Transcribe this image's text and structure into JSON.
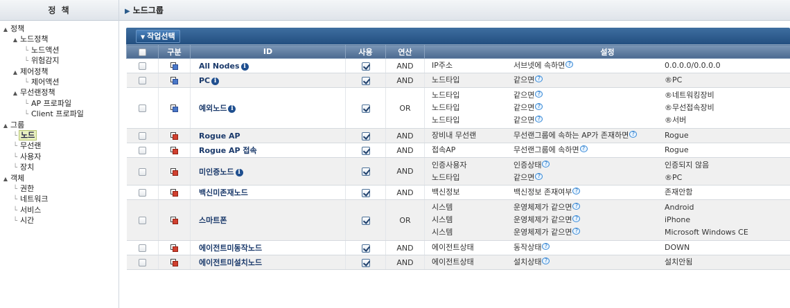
{
  "left_panel": {
    "title": "정 책",
    "tree": [
      {
        "label": "정책",
        "level": 0,
        "expanded": true
      },
      {
        "label": "노드정책",
        "level": 1,
        "expanded": true
      },
      {
        "label": "노드액션",
        "level": 2
      },
      {
        "label": "위험감지",
        "level": 2
      },
      {
        "label": "제어정책",
        "level": 1,
        "expanded": true
      },
      {
        "label": "제어액션",
        "level": 2
      },
      {
        "label": "무선랜정책",
        "level": 1,
        "expanded": true
      },
      {
        "label": "AP 프로파일",
        "level": 2
      },
      {
        "label": "Client 프로파일",
        "level": 2
      },
      {
        "label": "그룹",
        "level": 0,
        "expanded": true
      },
      {
        "label": "노드",
        "level": 1,
        "selected": true
      },
      {
        "label": "무선랜",
        "level": 1
      },
      {
        "label": "사용자",
        "level": 1
      },
      {
        "label": "장치",
        "level": 1
      },
      {
        "label": "객체",
        "level": 0,
        "expanded": true
      },
      {
        "label": "권한",
        "level": 1
      },
      {
        "label": "네트워크",
        "level": 1
      },
      {
        "label": "서비스",
        "level": 1
      },
      {
        "label": "시간",
        "level": 1
      }
    ]
  },
  "main": {
    "breadcrumb": "노드그룹",
    "action_button": "작업선택",
    "columns": {
      "type": "구분",
      "id": "ID",
      "use": "사용",
      "op": "연산",
      "settings": "설정"
    },
    "rows": [
      {
        "id": "All Nodes",
        "info": true,
        "icon": "blue",
        "op": "AND",
        "conds": [
          [
            "IP주소",
            "서브넷에 속하면",
            "0.0.0.0/0.0.0.0"
          ]
        ]
      },
      {
        "id": "PC",
        "info": true,
        "icon": "blue",
        "op": "AND",
        "conds": [
          [
            "노드타입",
            "같으면",
            "®PC"
          ]
        ]
      },
      {
        "id": "예외노드",
        "info": true,
        "icon": "blue",
        "op": "OR",
        "conds": [
          [
            "노드타입",
            "같으면",
            "®네트워킹장비"
          ],
          [
            "노드타입",
            "같으면",
            "®무선접속장비"
          ],
          [
            "노드타입",
            "같으면",
            "®서버"
          ]
        ]
      },
      {
        "id": "Rogue AP",
        "info": false,
        "icon": "red",
        "op": "AND",
        "conds": [
          [
            "장비내 무선랜",
            "무선랜그룹에 속하는 AP가 존재하면",
            "Rogue"
          ]
        ]
      },
      {
        "id": "Rogue AP 접속",
        "info": false,
        "icon": "red",
        "op": "AND",
        "conds": [
          [
            "접속AP",
            "무선랜그룹에 속하면",
            "Rogue"
          ]
        ]
      },
      {
        "id": "미인증노드",
        "info": true,
        "icon": "red",
        "op": "AND",
        "conds": [
          [
            "인증사용자",
            "인증상태",
            "인증되지 않음"
          ],
          [
            "노드타입",
            "같으면",
            "®PC"
          ]
        ]
      },
      {
        "id": "백신미존재노드",
        "info": false,
        "icon": "red",
        "op": "AND",
        "conds": [
          [
            "백신정보",
            "백신정보 존재여부",
            "존재안함"
          ]
        ]
      },
      {
        "id": "스마트폰",
        "info": false,
        "icon": "red",
        "op": "OR",
        "conds": [
          [
            "시스템",
            "운영체제가 같으면",
            "Android"
          ],
          [
            "시스템",
            "운영체제가 같으면",
            "iPhone"
          ],
          [
            "시스템",
            "운영체제가 같으면",
            "Microsoft Windows CE"
          ]
        ]
      },
      {
        "id": "에이전트미동작노드",
        "info": false,
        "icon": "red",
        "op": "AND",
        "conds": [
          [
            "에이전트상태",
            "동작상태",
            "DOWN"
          ]
        ]
      },
      {
        "id": "에이전트미설치노드",
        "info": false,
        "icon": "red",
        "op": "AND",
        "conds": [
          [
            "에이전트상태",
            "설치상태",
            "설치안됨"
          ]
        ]
      }
    ]
  }
}
